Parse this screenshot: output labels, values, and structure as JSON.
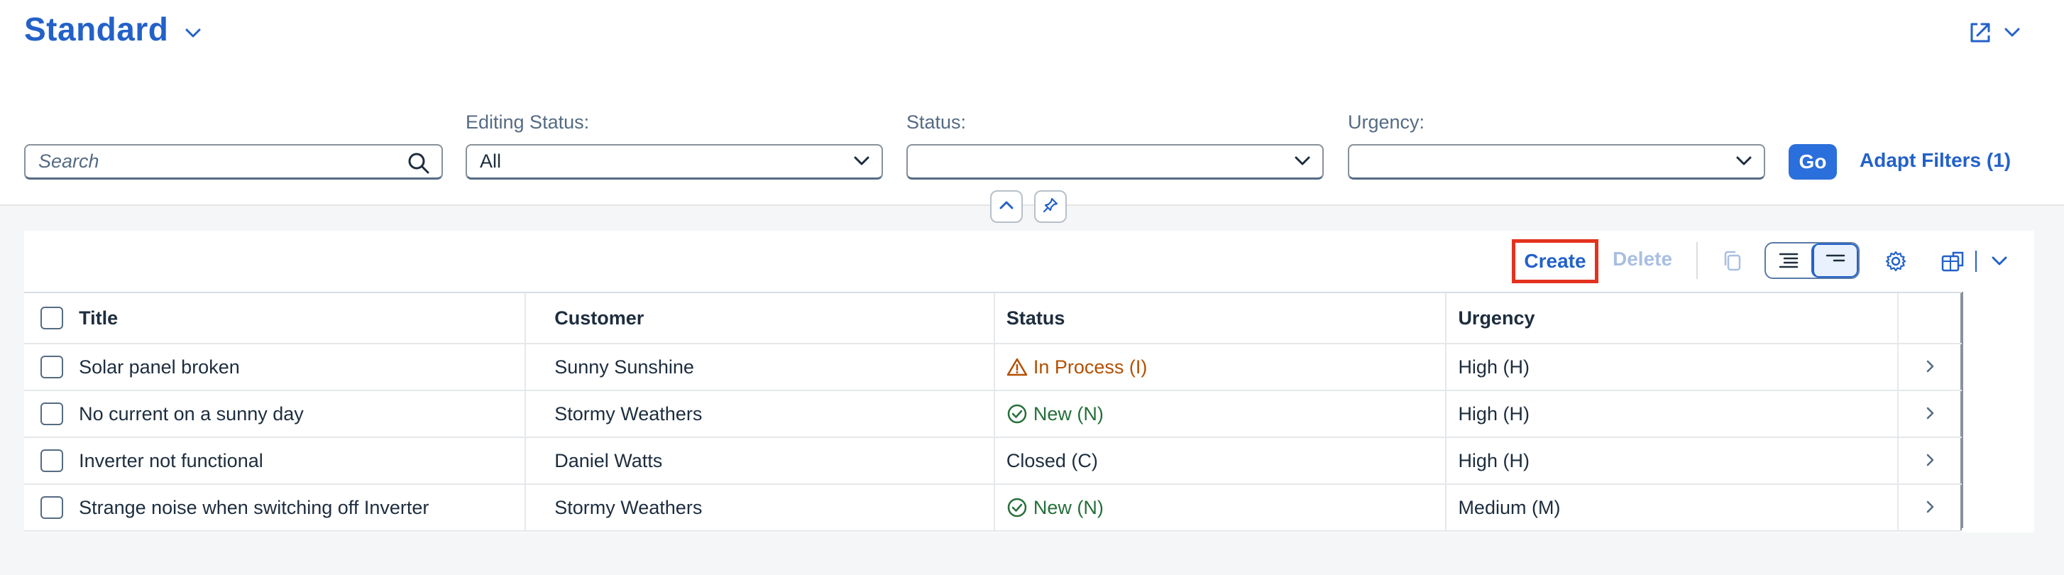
{
  "header": {
    "variant_title": "Standard"
  },
  "filters": {
    "search": {
      "placeholder": "Search",
      "value": ""
    },
    "editing_status": {
      "label": "Editing Status:",
      "value": "All"
    },
    "status": {
      "label": "Status:",
      "value": ""
    },
    "urgency": {
      "label": "Urgency:",
      "value": ""
    },
    "go_label": "Go",
    "adapt_label": "Adapt Filters (1)"
  },
  "toolbar": {
    "create_label": "Create",
    "delete_label": "Delete"
  },
  "table": {
    "columns": [
      "Title",
      "Customer",
      "Status",
      "Urgency"
    ],
    "rows": [
      {
        "title": "Solar panel broken",
        "customer": "Sunny Sunshine",
        "status": "In Process (I)",
        "status_kind": "warning",
        "urgency": "High (H)"
      },
      {
        "title": "No current on a sunny day",
        "customer": "Stormy Weathers",
        "status": "New (N)",
        "status_kind": "success",
        "urgency": "High (H)"
      },
      {
        "title": "Inverter not functional",
        "customer": "Daniel Watts",
        "status": "Closed (C)",
        "status_kind": "none",
        "urgency": "High (H)"
      },
      {
        "title": "Strange noise when switching off Inverter",
        "customer": "Stormy Weathers",
        "status": "New (N)",
        "status_kind": "success",
        "urgency": "Medium (M)"
      }
    ]
  },
  "colors": {
    "brand_blue": "#2361c9",
    "warning": "#b44f00",
    "success": "#256f3a",
    "highlight_border": "#e3321f"
  }
}
